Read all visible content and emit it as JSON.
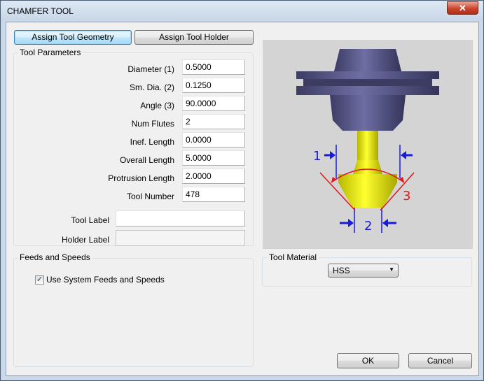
{
  "window": {
    "title": "CHAMFER TOOL",
    "close_glyph": "✕"
  },
  "tabs": {
    "geometry_label": "Assign Tool Geometry",
    "holder_label": "Assign Tool Holder"
  },
  "tool_parameters": {
    "group_title": "Tool Parameters",
    "fields": [
      {
        "label": "Diameter (1)",
        "value": "0.5000"
      },
      {
        "label": "Sm. Dia. (2)",
        "value": "0.1250"
      },
      {
        "label": "Angle (3)",
        "value": "90.0000"
      },
      {
        "label": "Num Flutes",
        "value": "2"
      },
      {
        "label": "Inef. Length",
        "value": "0.0000"
      },
      {
        "label": "Overall Length",
        "value": "5.0000"
      },
      {
        "label": "Protrusion Length",
        "value": "2.0000"
      },
      {
        "label": "Tool Number",
        "value": "478"
      }
    ],
    "tool_label": {
      "label": "Tool Label",
      "value": ""
    },
    "holder_label": {
      "label": "Holder Label",
      "value": ""
    }
  },
  "feeds_speeds": {
    "group_title": "Feeds and Speeds",
    "checkbox_label": "Use System Feeds and Speeds",
    "checked_glyph": "✓"
  },
  "tool_material": {
    "group_title": "Tool Material",
    "selected": "HSS",
    "arrow_glyph": "▼"
  },
  "diagram": {
    "label_1": "1",
    "label_2": "2",
    "label_3": "3"
  },
  "footer": {
    "ok_label": "OK",
    "cancel_label": "Cancel"
  },
  "colors": {
    "dimension_blue": "#1a1adc",
    "angle_red": "#e01818",
    "tool_yellow": "#f0f000",
    "holder_purple": "#4a4a78"
  }
}
